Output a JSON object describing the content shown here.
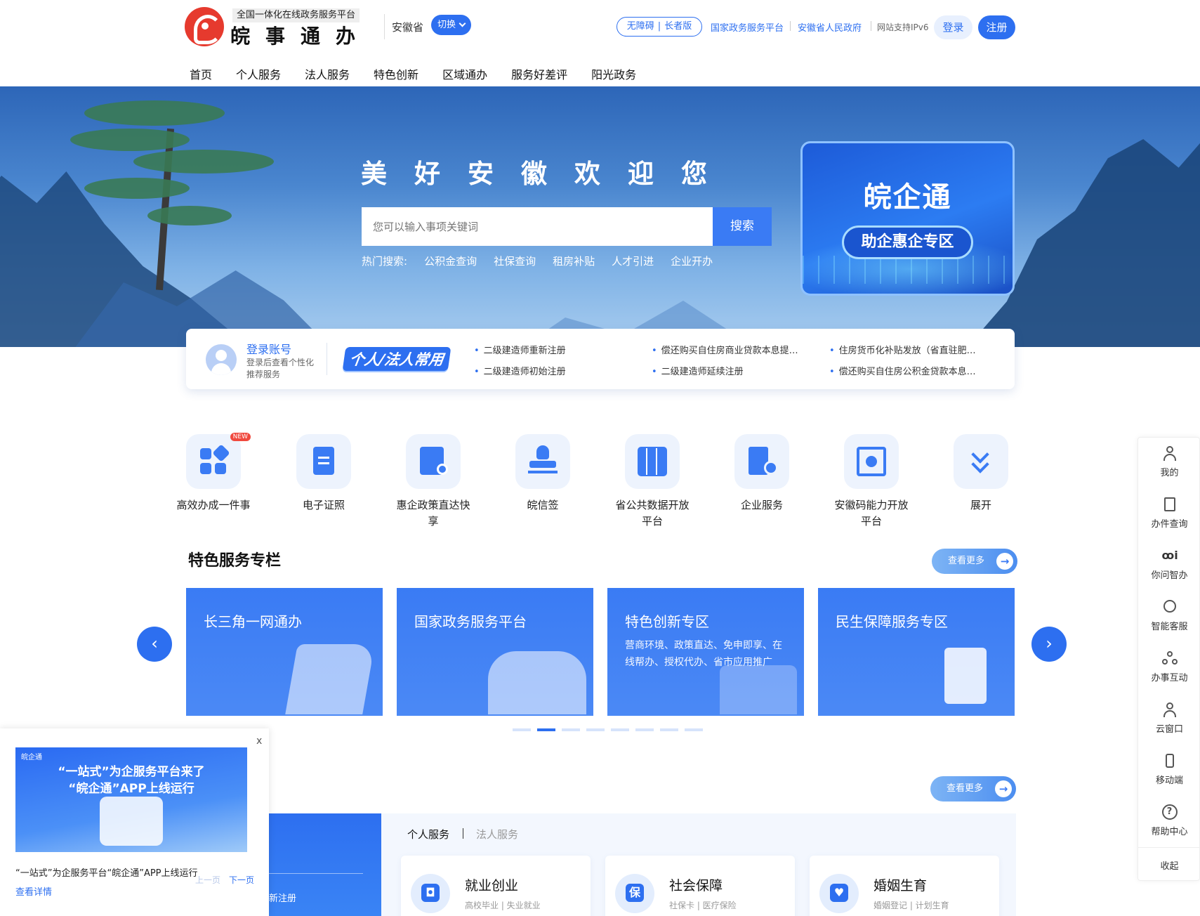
{
  "header": {
    "logo_subtitle": "全国一体化在线政务服务平台",
    "logo_title": "皖事通办",
    "province": "安徽省",
    "switch_label": "切换",
    "accessibility": "无障碍",
    "elder": "长者版",
    "links": [
      "国家政务服务平台",
      "安徽省人民政府"
    ],
    "ipv6": "网站支持IPv6",
    "login": "登录",
    "register": "注册"
  },
  "nav": [
    "首页",
    "个人服务",
    "法人服务",
    "特色创新",
    "区域通办",
    "服务好差评",
    "阳光政务"
  ],
  "hero": {
    "title": "美好安徽欢迎您",
    "search_placeholder": "您可以输入事项关键词",
    "search_button": "搜索",
    "hot_label": "热门搜索:",
    "hot_items": [
      "公积金查询",
      "社保查询",
      "租房补贴",
      "人才引进",
      "企业开办"
    ]
  },
  "promo": {
    "title": "皖企通",
    "button": "助企惠企专区"
  },
  "strip": {
    "login_title": "登录账号",
    "login_hint": "登录后查看个性化推荐服务",
    "badge": "个人/法人常用",
    "links": [
      "二级建造师重新注册",
      "二级建造师初始注册",
      "偿还购买自住房商业贷款本息提…",
      "二级建造师延续注册",
      "住房货币化补贴发放（省直驻肥…",
      "偿还购买自住房公积金贷款本息…"
    ]
  },
  "services": [
    {
      "label": "高效办成一件事",
      "badge": "NEW"
    },
    {
      "label": "电子证照"
    },
    {
      "label": "惠企政策直达快享"
    },
    {
      "label": "皖信签"
    },
    {
      "label": "省公共数据开放平台"
    },
    {
      "label": "企业服务"
    },
    {
      "label": "安徽码能力开放平台"
    },
    {
      "label": "展开"
    }
  ],
  "featured": {
    "title": "特色服务专栏",
    "more": "查看更多",
    "cards": [
      {
        "title": "长三角一网通办",
        "desc": ""
      },
      {
        "title": "国家政务服务平台",
        "desc": ""
      },
      {
        "title": "特色创新专区",
        "desc": "营商环境、政策直达、免申即享、在线帮办、授权代办、省市应用推广"
      },
      {
        "title": "民生保障服务专区",
        "desc": ""
      }
    ],
    "dot_count": 8,
    "active_dot": 1
  },
  "panel": {
    "more": "查看更多",
    "left_text": "新注册",
    "left_text2": "…",
    "tabs": [
      "个人服务",
      "法人服务"
    ],
    "cards": [
      {
        "title": "就业创业",
        "sub": "高校毕业 | 失业就业",
        "icon": "bag-icon"
      },
      {
        "title": "社会保障",
        "sub": "社保卡 | 医疗保险",
        "icon": "shield-icon"
      },
      {
        "title": "婚姻生育",
        "sub": "婚姻登记 | 计划生育",
        "icon": "heart-icon"
      }
    ]
  },
  "sidebar": {
    "items": [
      "我的",
      "办件查询",
      "你问智办",
      "智能客服",
      "办事互动",
      "云窗口",
      "移动端",
      "帮助中心"
    ],
    "collapse": "收起"
  },
  "popup": {
    "close": "x",
    "brand": "皖企通",
    "headline1": "“一站式”为企服务平台来了",
    "headline2": "“皖企通”APP上线运行",
    "caption": "“一站式”为企服务平台“皖企通”APP上线运行",
    "detail": "查看详情",
    "prev": "上一页",
    "next": "下一页"
  },
  "colors": {
    "primary": "#2d6ff0",
    "logo_red": "#e63a2e",
    "new_badge": "#f0493e"
  }
}
